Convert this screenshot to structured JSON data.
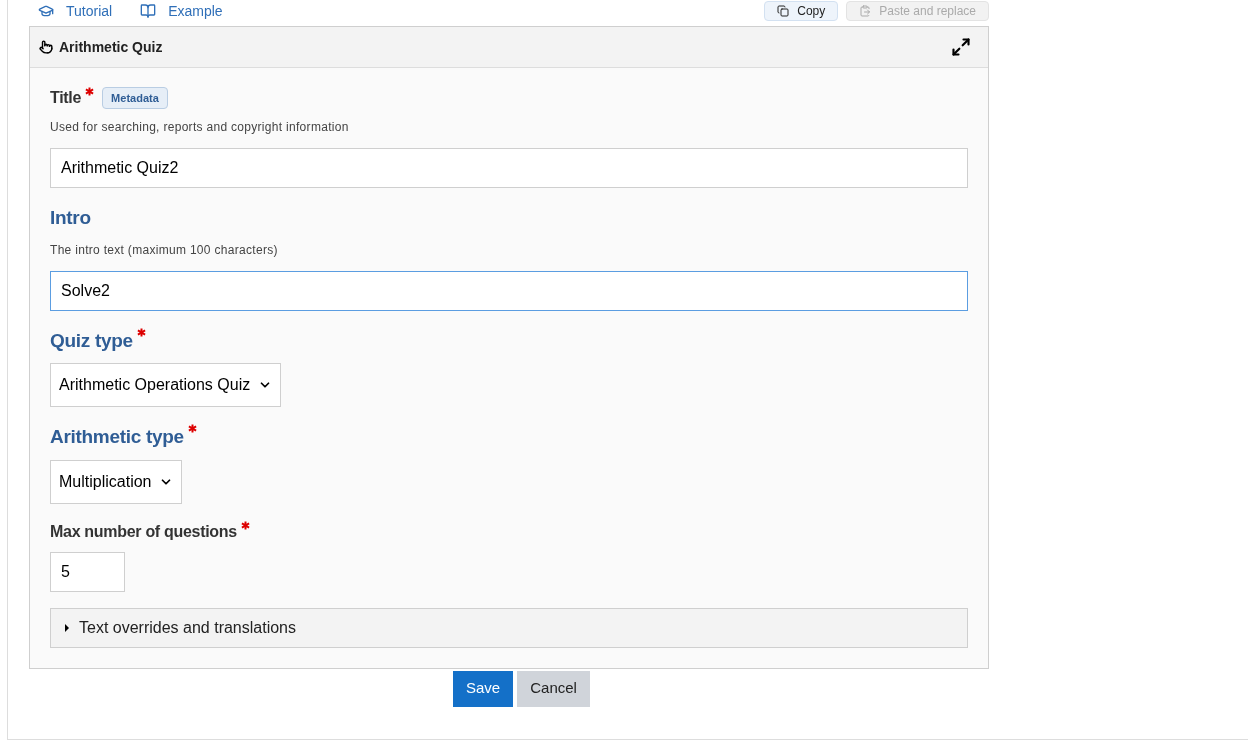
{
  "top_links": [
    {
      "label": "Tutorial",
      "kind": "tutorial"
    },
    {
      "label": "Example",
      "kind": "example"
    }
  ],
  "top_buttons": [
    {
      "label": "Copy",
      "disabled": false
    },
    {
      "label": "Paste and replace",
      "disabled": true
    }
  ],
  "panel": {
    "title": "Arithmetic Quiz",
    "fields": [
      {
        "kind": "text",
        "label": "Title",
        "required": true,
        "emphasis": false,
        "badge": "Metadata",
        "description": "Used for searching, reports and copyright information",
        "value": "Arithmetic Quiz2",
        "focused": false
      },
      {
        "kind": "text",
        "label": "Intro",
        "required": false,
        "emphasis": true,
        "description": "The intro text (maximum 100 characters)",
        "value": "Solve2",
        "focused": true
      },
      {
        "kind": "select",
        "label": "Quiz type",
        "required": true,
        "emphasis": true,
        "value": "Arithmetic Operations Quiz",
        "focused": false
      },
      {
        "kind": "select",
        "label": "Arithmetic type",
        "required": true,
        "emphasis": true,
        "value": "Multiplication",
        "focused": false
      },
      {
        "kind": "number",
        "label": "Max number of questions",
        "required": true,
        "emphasis": false,
        "value": "5",
        "focused": false
      }
    ],
    "collapsible": {
      "label": "Text overrides and translations",
      "expanded": false
    }
  },
  "buttons": [
    {
      "label": "Save",
      "kind": "primary"
    },
    {
      "label": "Cancel",
      "kind": "secondary"
    }
  ]
}
